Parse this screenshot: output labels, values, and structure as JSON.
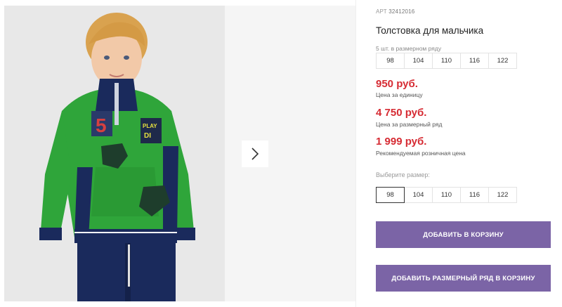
{
  "product": {
    "article_label": "АРТ",
    "article_number": "32412016",
    "title": "Толстовка для мальчика",
    "pack_label": "5 шт. в размерном ряду",
    "pack_sizes": [
      "98",
      "104",
      "110",
      "116",
      "122"
    ],
    "prices": [
      {
        "value": "950 руб.",
        "label": "Цена за единицу"
      },
      {
        "value": "4 750 руб.",
        "label": "Цена за размерный ряд"
      },
      {
        "value": "1 999 руб.",
        "label": "Рекомендуемая розничная цена"
      }
    ],
    "choose_size_label": "Выберите размер:",
    "select_sizes": [
      "98",
      "104",
      "110",
      "116",
      "122"
    ],
    "selected_size": "98",
    "add_to_cart": "ДОБАВИТЬ В КОРЗИНУ",
    "add_pack_to_cart": "ДОБАВИТЬ РАЗМЕРНЫЙ РЯД В КОРЗИНУ"
  },
  "gallery": {
    "next_icon": "chevron-right-icon",
    "patch_text_1": "PLAY",
    "patch_text_2": "DI",
    "patch_number": "5"
  },
  "colors": {
    "price": "#d62b33",
    "button": "#7b64a6",
    "sweater": "#2fa53a",
    "navy": "#1a2a5c"
  }
}
